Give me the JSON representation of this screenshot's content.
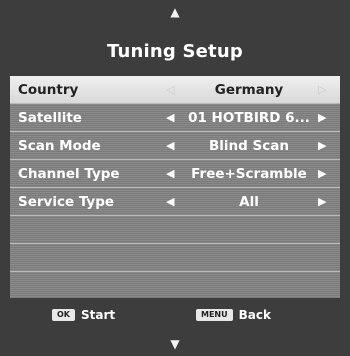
{
  "nav": {
    "up_arrow": "▲",
    "down_arrow": "▼"
  },
  "title": "Tuning Setup",
  "arrows": {
    "left": "◀",
    "right": "▶",
    "left_dim": "◁",
    "right_dim": "▷"
  },
  "rows": [
    {
      "label": "Country",
      "value": "Germany"
    },
    {
      "label": "Satellite",
      "value": "01 HOTBIRD 6..."
    },
    {
      "label": "Scan Mode",
      "value": "Blind Scan"
    },
    {
      "label": "Channel Type",
      "value": "Free+Scramble"
    },
    {
      "label": "Service Type",
      "value": "All"
    }
  ],
  "footer": {
    "ok_key": "OK",
    "ok_label": "Start",
    "menu_key": "MENU",
    "menu_label": "Back"
  }
}
